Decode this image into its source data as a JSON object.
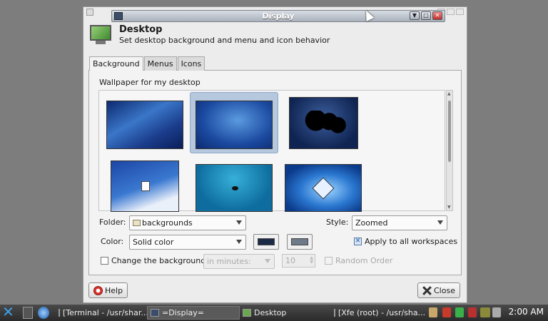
{
  "window": {
    "title": "Display",
    "header_title": "Desktop",
    "header_subtitle": "Set desktop background and menu and icon behavior"
  },
  "tabs": [
    {
      "label": "Background",
      "active": true
    },
    {
      "label": "Menus",
      "active": false
    },
    {
      "label": "Icons",
      "active": false
    }
  ],
  "background": {
    "wallpaper_label": "Wallpaper for my desktop",
    "wallpapers": [
      "blue-waves",
      "blue-glow",
      "world-map-flowers",
      "document-blue",
      "teal-ocean",
      "blue-xfce-mouse"
    ],
    "selected_index": 1,
    "folder_label": "Folder:",
    "folder_value": "backgrounds",
    "style_label": "Style:",
    "style_value": "Zoomed",
    "color_label": "Color:",
    "color_value": "Solid color",
    "color1": "#1b2b45",
    "color2": "#6e7a8a",
    "apply_all_label": "Apply to all workspaces",
    "apply_all_checked": true,
    "change_bg_label": "Change the background",
    "change_bg_checked": false,
    "interval_value": "in minutes:",
    "interval_number": "10",
    "random_label": "Random Order",
    "random_checked": false
  },
  "buttons": {
    "help": "Help",
    "close": "Close"
  },
  "taskbar": {
    "tasks": [
      {
        "label": "[Terminal - /usr/shar...",
        "active": false
      },
      {
        "label": "=Display=",
        "active": true
      },
      {
        "label": "Desktop",
        "active": false
      },
      {
        "label": "[Xfe (root) - /usr/sha...",
        "active": false
      }
    ],
    "clock": "2:00 AM"
  },
  "colors": {
    "accent": "#3fa0e8",
    "selection": "#b5c8de",
    "close_red": "#c0302a"
  }
}
